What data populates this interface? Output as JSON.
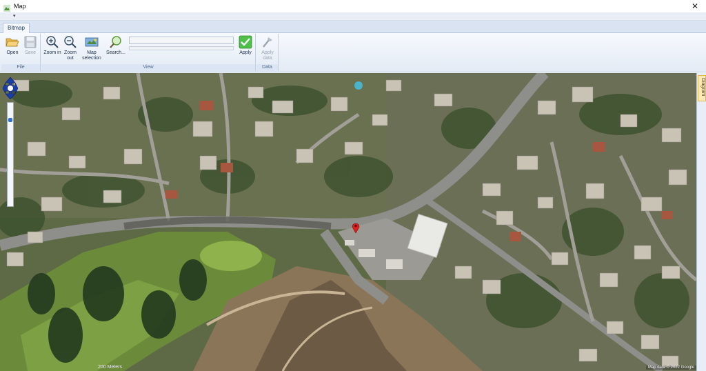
{
  "window": {
    "title": "Map",
    "close_label": "✕"
  },
  "qat": {
    "arrow": "▾"
  },
  "tabs": [
    {
      "label": "Bitmap"
    }
  ],
  "ribbon": {
    "groups": {
      "file": "File",
      "view": "View",
      "data": "Data"
    },
    "buttons": {
      "open": "Open",
      "save": "Save",
      "zoom_in": "Zoom in",
      "zoom_out": "Zoom out",
      "map_selection": "Map selection",
      "search": "Search...",
      "apply": "Apply",
      "apply_data": "Apply data"
    }
  },
  "map": {
    "scale_label": "200 Meters",
    "attribution": "Map data © 2022 Google",
    "zoom_level": 0.15
  },
  "side_panel": {
    "tab_label": "Diagram"
  },
  "colors": {
    "ribbon_bg": "#e4ebf5",
    "accent": "#2d6fd4",
    "marker": "#e0201b",
    "apply_check": "#3aa43a"
  }
}
